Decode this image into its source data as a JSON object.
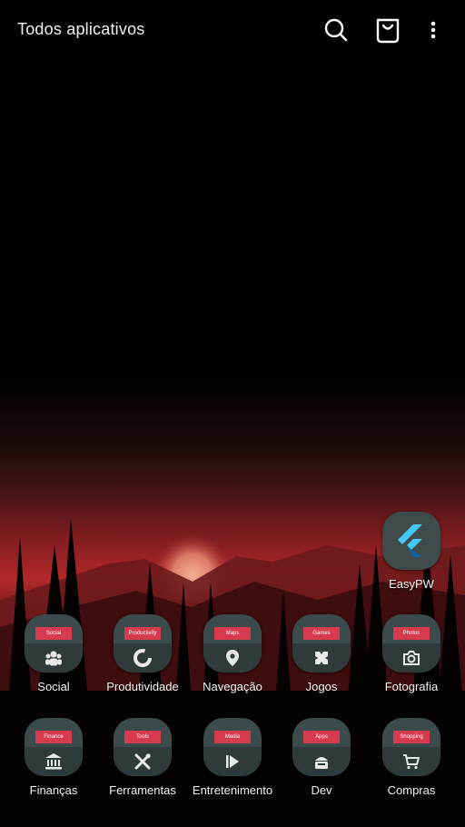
{
  "header": {
    "title": "Todos aplicativos",
    "icons": [
      "search-icon",
      "store-bag-icon",
      "more-vert-icon"
    ]
  },
  "featured_app": {
    "label": "EasyPW",
    "icon": "flutter-icon"
  },
  "apps_row1": [
    {
      "label": "Social",
      "tag": "Social",
      "icon": "people-icon"
    },
    {
      "label": "Produtividade",
      "tag": "Productivity",
      "icon": "pie-icon"
    },
    {
      "label": "Navegação",
      "tag": "Maps",
      "icon": "map-pin-icon"
    },
    {
      "label": "Jogos",
      "tag": "Games",
      "icon": "gamepad-icon"
    },
    {
      "label": "Fotografia",
      "tag": "Photos",
      "icon": "camera-icon"
    }
  ],
  "apps_row2": [
    {
      "label": "Finanças",
      "tag": "Finance",
      "icon": "bank-icon"
    },
    {
      "label": "Ferramentas",
      "tag": "Tools",
      "icon": "tools-icon"
    },
    {
      "label": "Entretenimento",
      "tag": "Media",
      "icon": "play-icon"
    },
    {
      "label": "Dev",
      "tag": "Apps",
      "icon": "android-icon"
    },
    {
      "label": "Compras",
      "tag": "Shopping",
      "icon": "cart-icon"
    }
  ],
  "colors": {
    "folder_bg": "#3b4a4a",
    "folder_tag": "#d73a4e",
    "sunset": "#c0292d"
  }
}
